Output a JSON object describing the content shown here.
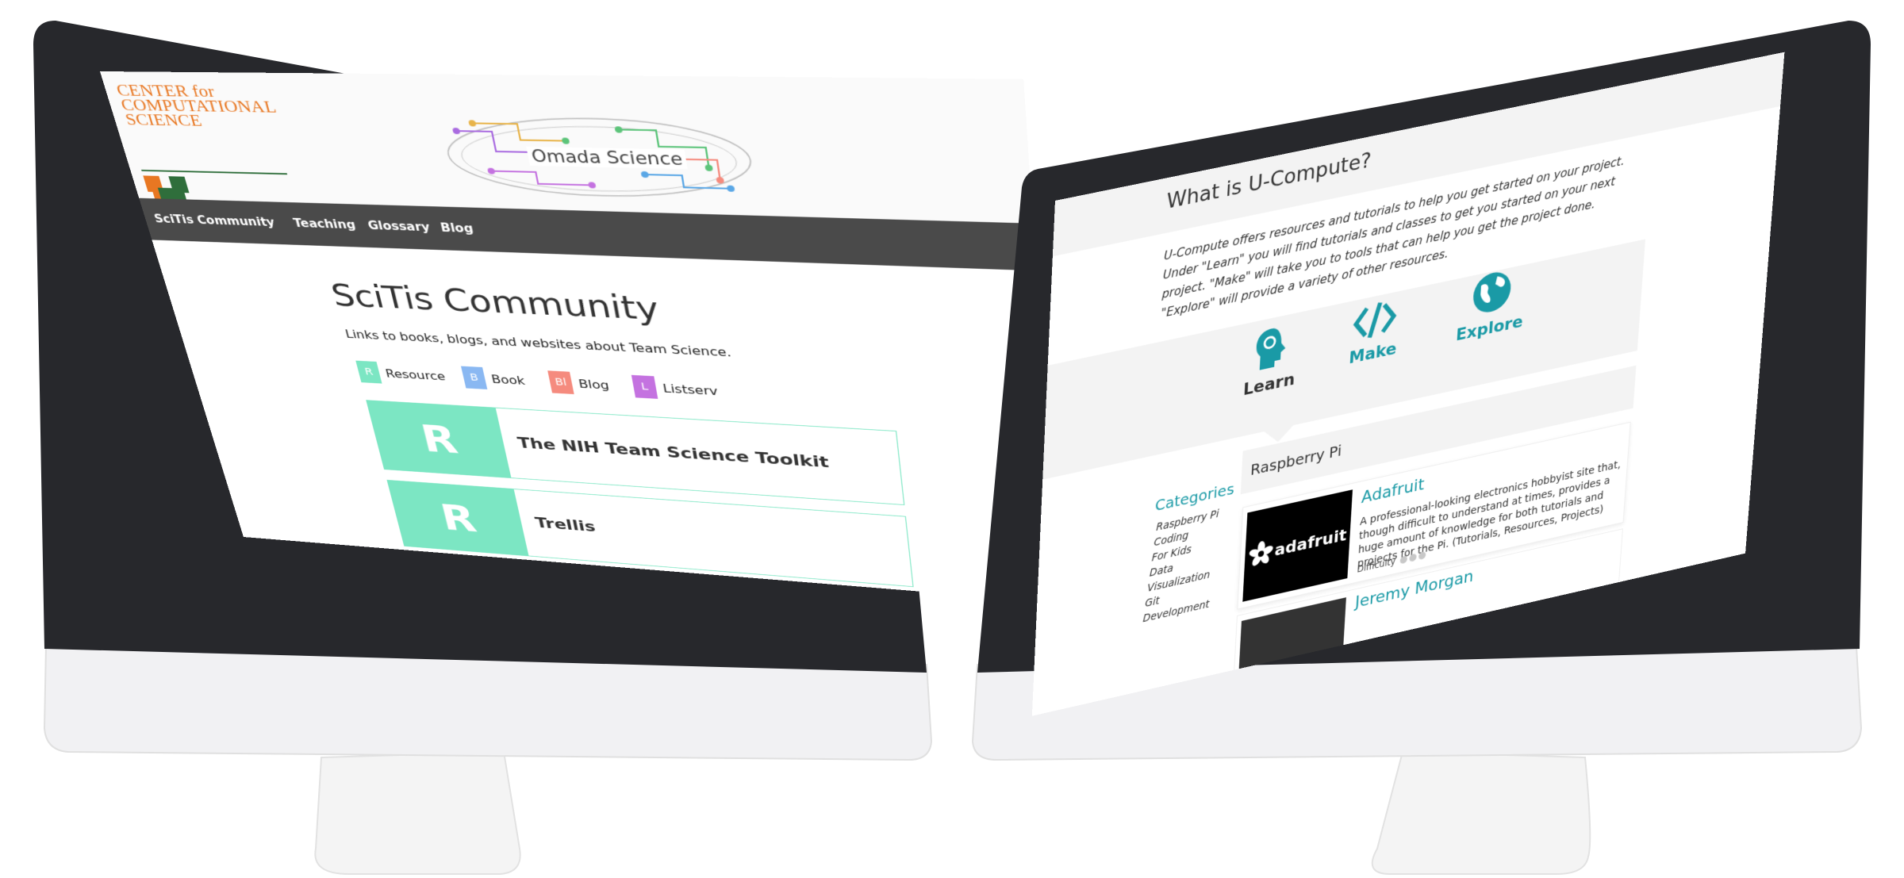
{
  "left_screen": {
    "logo_text": [
      "CENTER for",
      "COMPUTATIONAL",
      "SCIENCE"
    ],
    "omada_title": "Omada Science",
    "nav": [
      "SciTis Community",
      "Teaching",
      "Glossary",
      "Blog"
    ],
    "page_title": "SciTis Community",
    "subtitle": "Links to books, blogs, and websites about Team Science.",
    "legend": [
      {
        "badge": "R",
        "label": "Resource",
        "color": "#7ce6c3"
      },
      {
        "badge": "B",
        "label": "Book",
        "color": "#8ab8f2"
      },
      {
        "badge": "Bl",
        "label": "Blog",
        "color": "#f58b7e"
      },
      {
        "badge": "L",
        "label": "Listserv",
        "color": "#c472e0"
      }
    ],
    "cards": [
      {
        "badge": "R",
        "title": "The NIH Team Science Toolkit"
      },
      {
        "badge": "R",
        "title": "Trellis"
      }
    ]
  },
  "right_screen": {
    "title": "What is U-Compute?",
    "description": "U-Compute offers resources and tutorials to help you get started on your project. Under \"Learn\" you will find tutorials and classes to get you started on your next project. \"Make\" will take you to tools that can help you get the project done. \"Explore\" will provide a variety of other resources.",
    "sections": [
      {
        "label": "Learn",
        "icon": "brain-head-icon"
      },
      {
        "label": "Make",
        "icon": "code-icon"
      },
      {
        "label": "Explore",
        "icon": "globe-icon"
      }
    ],
    "categories_title": "Categories",
    "categories": [
      "Raspberry Pi",
      "Coding",
      "For Kids",
      "Data",
      "Visualization",
      "Git",
      "Development"
    ],
    "selected_category": "Raspberry Pi",
    "resources": [
      {
        "title": "Adafruit",
        "logo_text": "adafruit",
        "description": "A professional-looking electronics hobbyist site that, though difficult to understand at times, provides a huge amount of knowledge for both tutorials and projects for the Pi. (Tutorials, Resources, Projects)",
        "difficulty_label": "Difficulty"
      },
      {
        "title": "Jeremy Morgan"
      }
    ],
    "accent_color": "#1a9aa6"
  }
}
